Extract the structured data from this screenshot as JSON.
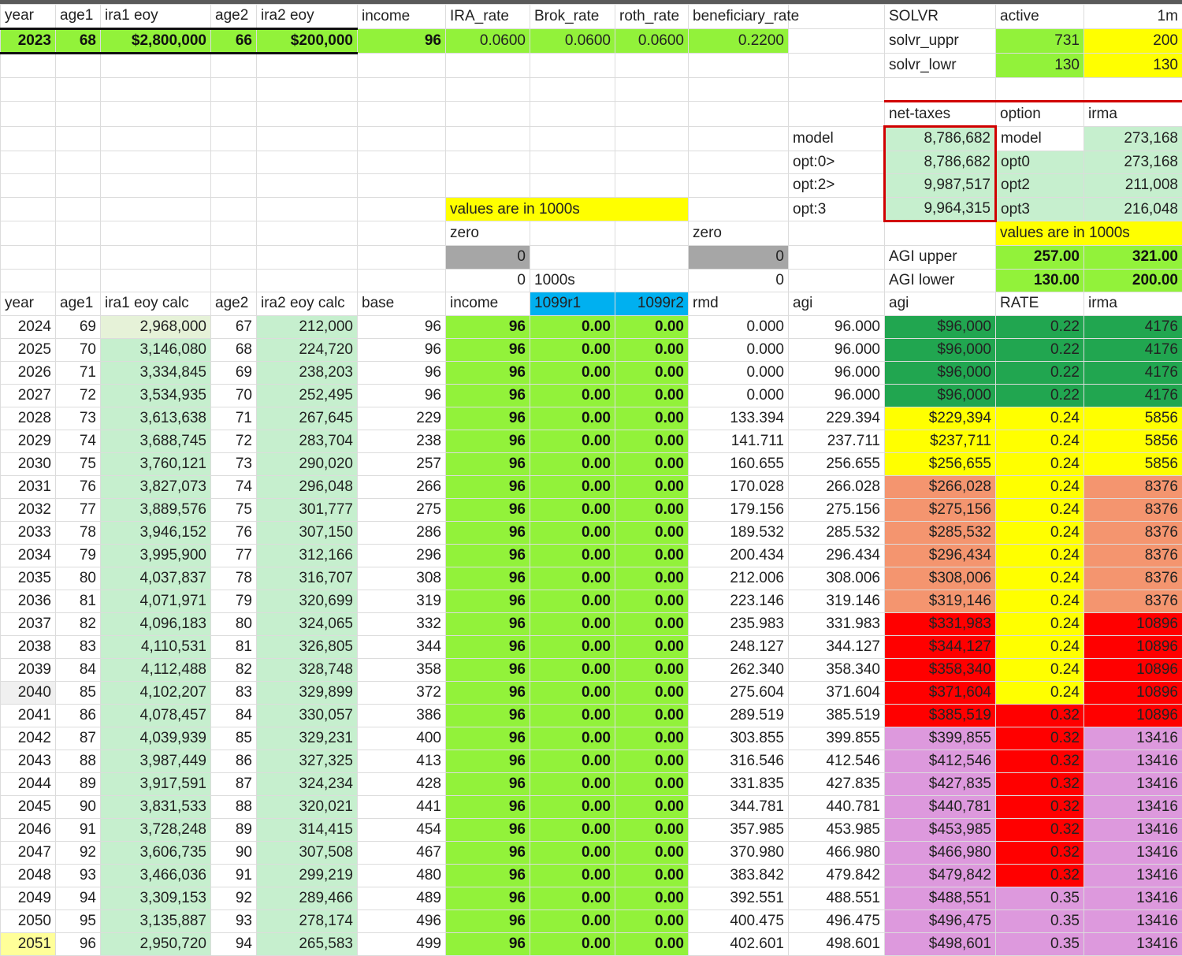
{
  "header1": {
    "year": "year",
    "age1": "age1",
    "ira1": "ira1 eoy",
    "age2": "age2",
    "ira2": "ira2 eoy",
    "income": "income",
    "ira_rate": "IRA_rate",
    "brok_rate": "Brok_rate",
    "roth_rate": "roth_rate",
    "beneficiary_rate": "beneficiary_rate",
    "solvr": "SOLVR",
    "active": "active",
    "one_m": "1m"
  },
  "inputs": {
    "year": "2023",
    "age1": "68",
    "ira1": "$2,800,000",
    "age2": "66",
    "ira2": "$200,000",
    "income": "96",
    "ira_rate": "0.0600",
    "brok_rate": "0.0600",
    "roth_rate": "0.0600",
    "beneficiary_rate": "0.2200"
  },
  "solver": {
    "upper_label": "solvr_uppr",
    "upper_active": "731",
    "upper_1m": "200",
    "lower_label": "solvr_lowr",
    "lower_active": "130",
    "lower_1m": "130"
  },
  "options": {
    "col_net_taxes": "net-taxes",
    "col_option": "option",
    "col_irma": "irma",
    "rows": [
      {
        "label": "model",
        "net": "8,786,682",
        "option": "model",
        "irma": "273,168"
      },
      {
        "label": "opt:0>",
        "net": "8,786,682",
        "option": "opt0",
        "irma": "273,168"
      },
      {
        "label": "opt:2>",
        "net": "9,987,517",
        "option": "opt2",
        "irma": "211,008"
      },
      {
        "label": "opt:3",
        "net": "9,964,315",
        "option": "opt3",
        "irma": "216,048"
      }
    ]
  },
  "notes": {
    "values_1000s_a": "values are in 1000s",
    "values_1000s_b": "values are in 1000s",
    "zero_a": "zero",
    "zero_b": "zero",
    "zero_val_a": "0",
    "zero_val_b": "0",
    "val_g12": "0",
    "thousands": "1000s",
    "val_j12": "0"
  },
  "agi_limits": {
    "upper_label": "AGI upper",
    "upper_a": "257.00",
    "upper_b": "321.00",
    "lower_label": "AGI lower",
    "lower_a": "130.00",
    "lower_b": "200.00"
  },
  "header2": {
    "year": "year",
    "age1": "age1",
    "ira1": "ira1 eoy calc",
    "age2": "age2",
    "ira2": "ira2 eoy calc",
    "base": "base",
    "income": "income",
    "r1": "1099r1",
    "r2": "1099r2",
    "rmd": "rmd",
    "agi": "agi",
    "agi2": "agi",
    "rate": "RATE",
    "irma": "irma"
  },
  "colors": {
    "green": "#21a650",
    "yellow": "#ffff00",
    "salmon": "#f4956f",
    "red": "#ff0000",
    "purple": "#dd99dd"
  },
  "rows": [
    [
      "2024",
      "69",
      "2,968,000",
      "67",
      "212,000",
      "96",
      "96",
      "0.00",
      "0.00",
      "0.000",
      "96.000",
      "$96,000",
      "0.22",
      "4176",
      "green",
      "green"
    ],
    [
      "2025",
      "70",
      "3,146,080",
      "68",
      "224,720",
      "96",
      "96",
      "0.00",
      "0.00",
      "0.000",
      "96.000",
      "$96,000",
      "0.22",
      "4176",
      "green",
      "green"
    ],
    [
      "2026",
      "71",
      "3,334,845",
      "69",
      "238,203",
      "96",
      "96",
      "0.00",
      "0.00",
      "0.000",
      "96.000",
      "$96,000",
      "0.22",
      "4176",
      "green",
      "green"
    ],
    [
      "2027",
      "72",
      "3,534,935",
      "70",
      "252,495",
      "96",
      "96",
      "0.00",
      "0.00",
      "0.000",
      "96.000",
      "$96,000",
      "0.22",
      "4176",
      "green",
      "green"
    ],
    [
      "2028",
      "73",
      "3,613,638",
      "71",
      "267,645",
      "229",
      "96",
      "0.00",
      "0.00",
      "133.394",
      "229.394",
      "$229,394",
      "0.24",
      "5856",
      "yellow",
      "yellow"
    ],
    [
      "2029",
      "74",
      "3,688,745",
      "72",
      "283,704",
      "238",
      "96",
      "0.00",
      "0.00",
      "141.711",
      "237.711",
      "$237,711",
      "0.24",
      "5856",
      "yellow",
      "yellow"
    ],
    [
      "2030",
      "75",
      "3,760,121",
      "73",
      "290,020",
      "257",
      "96",
      "0.00",
      "0.00",
      "160.655",
      "256.655",
      "$256,655",
      "0.24",
      "5856",
      "yellow",
      "yellow"
    ],
    [
      "2031",
      "76",
      "3,827,073",
      "74",
      "296,048",
      "266",
      "96",
      "0.00",
      "0.00",
      "170.028",
      "266.028",
      "$266,028",
      "0.24",
      "8376",
      "salmon",
      "yellow"
    ],
    [
      "2032",
      "77",
      "3,889,576",
      "75",
      "301,777",
      "275",
      "96",
      "0.00",
      "0.00",
      "179.156",
      "275.156",
      "$275,156",
      "0.24",
      "8376",
      "salmon",
      "yellow"
    ],
    [
      "2033",
      "78",
      "3,946,152",
      "76",
      "307,150",
      "286",
      "96",
      "0.00",
      "0.00",
      "189.532",
      "285.532",
      "$285,532",
      "0.24",
      "8376",
      "salmon",
      "yellow"
    ],
    [
      "2034",
      "79",
      "3,995,900",
      "77",
      "312,166",
      "296",
      "96",
      "0.00",
      "0.00",
      "200.434",
      "296.434",
      "$296,434",
      "0.24",
      "8376",
      "salmon",
      "yellow"
    ],
    [
      "2035",
      "80",
      "4,037,837",
      "78",
      "316,707",
      "308",
      "96",
      "0.00",
      "0.00",
      "212.006",
      "308.006",
      "$308,006",
      "0.24",
      "8376",
      "salmon",
      "yellow"
    ],
    [
      "2036",
      "81",
      "4,071,971",
      "79",
      "320,699",
      "319",
      "96",
      "0.00",
      "0.00",
      "223.146",
      "319.146",
      "$319,146",
      "0.24",
      "8376",
      "salmon",
      "yellow"
    ],
    [
      "2037",
      "82",
      "4,096,183",
      "80",
      "324,065",
      "332",
      "96",
      "0.00",
      "0.00",
      "235.983",
      "331.983",
      "$331,983",
      "0.24",
      "10896",
      "red",
      "yellow"
    ],
    [
      "2038",
      "83",
      "4,110,531",
      "81",
      "326,805",
      "344",
      "96",
      "0.00",
      "0.00",
      "248.127",
      "344.127",
      "$344,127",
      "0.24",
      "10896",
      "red",
      "yellow"
    ],
    [
      "2039",
      "84",
      "4,112,488",
      "82",
      "328,748",
      "358",
      "96",
      "0.00",
      "0.00",
      "262.340",
      "358.340",
      "$358,340",
      "0.24",
      "10896",
      "red",
      "yellow"
    ],
    [
      "2040",
      "85",
      "4,102,207",
      "83",
      "329,899",
      "372",
      "96",
      "0.00",
      "0.00",
      "275.604",
      "371.604",
      "$371,604",
      "0.24",
      "10896",
      "red",
      "yellow"
    ],
    [
      "2041",
      "86",
      "4,078,457",
      "84",
      "330,057",
      "386",
      "96",
      "0.00",
      "0.00",
      "289.519",
      "385.519",
      "$385,519",
      "0.32",
      "10896",
      "red",
      "red"
    ],
    [
      "2042",
      "87",
      "4,039,939",
      "85",
      "329,231",
      "400",
      "96",
      "0.00",
      "0.00",
      "303.855",
      "399.855",
      "$399,855",
      "0.32",
      "13416",
      "purple",
      "red"
    ],
    [
      "2043",
      "88",
      "3,987,449",
      "86",
      "327,325",
      "413",
      "96",
      "0.00",
      "0.00",
      "316.546",
      "412.546",
      "$412,546",
      "0.32",
      "13416",
      "purple",
      "red"
    ],
    [
      "2044",
      "89",
      "3,917,591",
      "87",
      "324,234",
      "428",
      "96",
      "0.00",
      "0.00",
      "331.835",
      "427.835",
      "$427,835",
      "0.32",
      "13416",
      "purple",
      "red"
    ],
    [
      "2045",
      "90",
      "3,831,533",
      "88",
      "320,021",
      "441",
      "96",
      "0.00",
      "0.00",
      "344.781",
      "440.781",
      "$440,781",
      "0.32",
      "13416",
      "purple",
      "red"
    ],
    [
      "2046",
      "91",
      "3,728,248",
      "89",
      "314,415",
      "454",
      "96",
      "0.00",
      "0.00",
      "357.985",
      "453.985",
      "$453,985",
      "0.32",
      "13416",
      "purple",
      "red"
    ],
    [
      "2047",
      "92",
      "3,606,735",
      "90",
      "307,508",
      "467",
      "96",
      "0.00",
      "0.00",
      "370.980",
      "466.980",
      "$466,980",
      "0.32",
      "13416",
      "purple",
      "red"
    ],
    [
      "2048",
      "93",
      "3,466,036",
      "91",
      "299,219",
      "480",
      "96",
      "0.00",
      "0.00",
      "383.842",
      "479.842",
      "$479,842",
      "0.32",
      "13416",
      "purple",
      "red"
    ],
    [
      "2049",
      "94",
      "3,309,153",
      "92",
      "289,466",
      "489",
      "96",
      "0.00",
      "0.00",
      "392.551",
      "488.551",
      "$488,551",
      "0.35",
      "13416",
      "purple",
      "purple"
    ],
    [
      "2050",
      "95",
      "3,135,887",
      "93",
      "278,174",
      "496",
      "96",
      "0.00",
      "0.00",
      "400.475",
      "496.475",
      "$496,475",
      "0.35",
      "13416",
      "purple",
      "purple"
    ],
    [
      "2051",
      "96",
      "2,950,720",
      "94",
      "265,583",
      "499",
      "96",
      "0.00",
      "0.00",
      "402.601",
      "498.601",
      "$498,601",
      "0.35",
      "13416",
      "purple",
      "purple"
    ]
  ]
}
